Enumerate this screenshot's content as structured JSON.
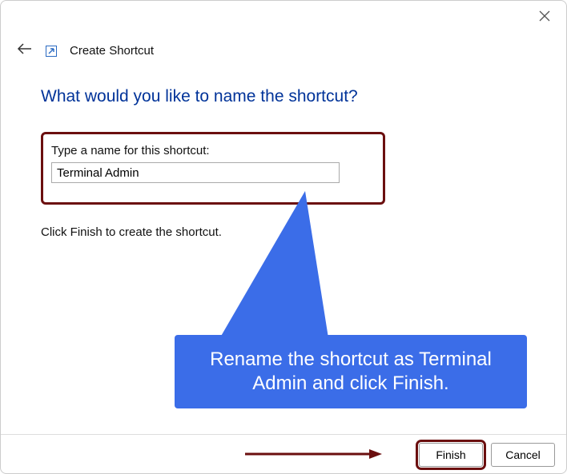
{
  "window": {
    "title": "Create Shortcut"
  },
  "heading": "What would you like to name the shortcut?",
  "field": {
    "label": "Type a name for this shortcut:",
    "value": "Terminal Admin"
  },
  "instruction": "Click Finish to create the shortcut.",
  "callout": "Rename the shortcut as Terminal Admin and click Finish.",
  "buttons": {
    "finish": "Finish",
    "cancel": "Cancel"
  },
  "colors": {
    "accent": "#3b6de8",
    "highlight": "#6b0f0f",
    "heading": "#003399"
  }
}
